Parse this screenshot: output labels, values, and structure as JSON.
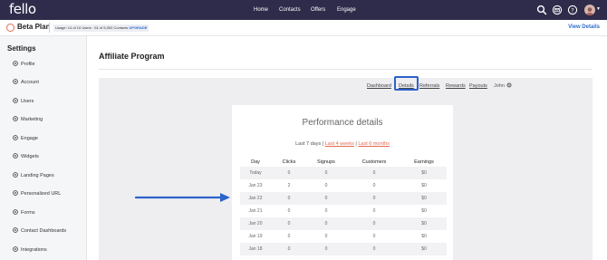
{
  "brand": {
    "logo": "fello"
  },
  "nav": [
    "Home",
    "Contacts",
    "Offers",
    "Engage"
  ],
  "icons": {
    "search": "search-icon",
    "mail": "mail-icon",
    "help": "help-icon",
    "avatar": "avatar-icon"
  },
  "plan": {
    "title": "Beta Plan",
    "usage_prefix": "Usage: 14 of 10 Users · 61 of 5,000 Contacts",
    "upgrade": "UPGRADE",
    "view_details": "View Details"
  },
  "sidebar": {
    "title": "Settings",
    "items": [
      {
        "label": "Profile",
        "icon": "user-icon"
      },
      {
        "label": "Account",
        "icon": "account-icon"
      },
      {
        "label": "Users",
        "icon": "users-icon"
      },
      {
        "label": "Marketing",
        "icon": "marketing-icon"
      },
      {
        "label": "Engage",
        "icon": "engage-icon"
      },
      {
        "label": "Widgets",
        "icon": "widgets-icon"
      },
      {
        "label": "Landing Pages",
        "icon": "landing-pages-icon"
      },
      {
        "label": "Personalized URL",
        "icon": "grid-icon"
      },
      {
        "label": "Forms",
        "icon": "forms-icon"
      },
      {
        "label": "Contact Dashboards",
        "icon": "dashboard-icon"
      },
      {
        "label": "Integrations",
        "icon": "integrations-icon"
      }
    ]
  },
  "page": {
    "title": "Affiliate Program"
  },
  "tabs": [
    "Dashboard",
    "Details",
    "Referrals",
    "Rewards",
    "Payouts"
  ],
  "tab_user": "John",
  "active_tab": "Details",
  "performance": {
    "title": "Performance details",
    "range_active": "Last 7 days",
    "range_sep": "|",
    "range_links": [
      "Last 4 weeks",
      "Last 6 months"
    ],
    "columns": [
      "Day",
      "Clicks",
      "Signups",
      "Customers",
      "Earnings"
    ],
    "rows": [
      [
        "Today",
        "0",
        "0",
        "0",
        "$0"
      ],
      [
        "Jan 23",
        "2",
        "0",
        "0",
        "$0"
      ],
      [
        "Jan 22",
        "0",
        "0",
        "0",
        "$0"
      ],
      [
        "Jan 21",
        "0",
        "0",
        "0",
        "$0"
      ],
      [
        "Jan 20",
        "0",
        "0",
        "0",
        "$0"
      ],
      [
        "Jan 19",
        "0",
        "0",
        "0",
        "$0"
      ],
      [
        "Jan 18",
        "0",
        "0",
        "0",
        "$0"
      ]
    ]
  },
  "colors": {
    "nav_bg": "#2f2c4b",
    "accent": "#e36b4f",
    "link": "#2f6ecb",
    "highlight": "#2c62c9",
    "arrow": "#2c62c9"
  }
}
